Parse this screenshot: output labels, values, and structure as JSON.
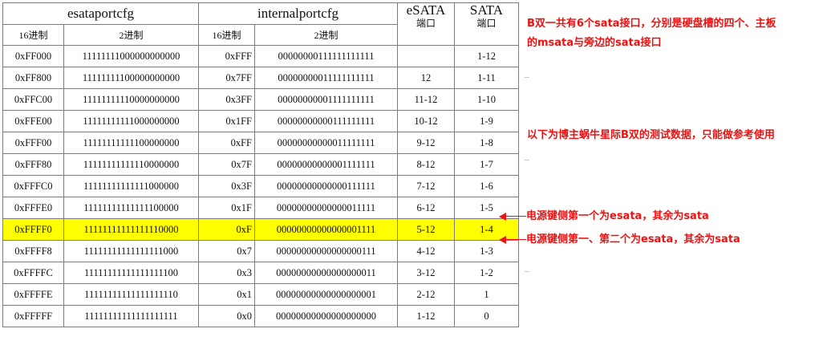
{
  "table": {
    "group_headers": [
      "esataportcfg",
      "internalportcfg",
      "eSATA",
      "SATA"
    ],
    "sub_headers": [
      "16进制",
      "2进制",
      "16进制",
      "2进制",
      "端口",
      "端口"
    ],
    "rows": [
      [
        "0xFF000",
        "11111111000000000000",
        "0xFFF",
        "00000000111111111111",
        "",
        "1-12"
      ],
      [
        "0xFF800",
        "11111111100000000000",
        "0x7FF",
        "00000000011111111111",
        "12",
        "1-11"
      ],
      [
        "0xFFC00",
        "11111111110000000000",
        "0x3FF",
        "00000000001111111111",
        "11-12",
        "1-10"
      ],
      [
        "0xFFE00",
        "11111111111000000000",
        "0x1FF",
        "00000000000111111111",
        "10-12",
        "1-9"
      ],
      [
        "0xFFF00",
        "11111111111100000000",
        "0xFF",
        "00000000000011111111",
        "9-12",
        "1-8"
      ],
      [
        "0xFFF80",
        "11111111111110000000",
        "0x7F",
        "00000000000001111111",
        "8-12",
        "1-7"
      ],
      [
        "0xFFFC0",
        "11111111111111000000",
        "0x3F",
        "00000000000000111111",
        "7-12",
        "1-6"
      ],
      [
        "0xFFFE0",
        "11111111111111100000",
        "0x1F",
        "00000000000000011111",
        "6-12",
        "1-5"
      ],
      [
        "0xFFFF0",
        "11111111111111110000",
        "0xF",
        "00000000000000001111",
        "5-12",
        "1-4"
      ],
      [
        "0xFFFF8",
        "11111111111111111000",
        "0x7",
        "00000000000000000111",
        "4-12",
        "1-3"
      ],
      [
        "0xFFFFC",
        "11111111111111111100",
        "0x3",
        "00000000000000000011",
        "3-12",
        "1-2"
      ],
      [
        "0xFFFFE",
        "11111111111111111110",
        "0x1",
        "00000000000000000001",
        "2-12",
        "1"
      ],
      [
        "0xFFFFF",
        "11111111111111111111",
        "0x0",
        "00000000000000000000",
        "1-12",
        "0"
      ]
    ],
    "highlight_color": "#ffff00"
  },
  "annotations": {
    "intro_line1": "B双一共有6个sata接口，分别是硬盘槽的四个、主板",
    "intro_line2": "的msata与旁边的sata接口",
    "test_data_note": "以下为博主蜗牛星际B双的测试数据，只能做参考使用",
    "note_row_1_5": "电源键侧第一个为esata，其余为sata",
    "note_row_1_4": "电源键侧第一、第二个为esata，其余为sata",
    "text_color": "#ee1111"
  }
}
